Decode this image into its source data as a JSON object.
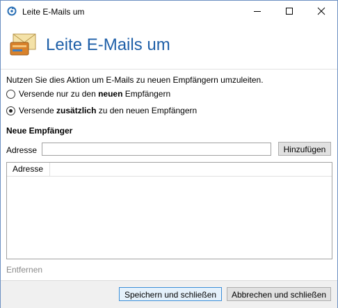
{
  "window": {
    "title": "Leite E-Mails um"
  },
  "banner": {
    "title": "Leite E-Mails um",
    "icon": "envelope-forward-icon"
  },
  "intro": {
    "text": "Nutzen Sie dies Aktion um E-Mails zu neuen Empfängern umzuleiten."
  },
  "options": {
    "only_new": {
      "prefix": "Versende nur zu den ",
      "bold": "neuen",
      "suffix": " Empfängern",
      "checked": false
    },
    "additional": {
      "prefix": "Versende ",
      "bold": "zusätzlich",
      "suffix": " zu den neuen Empfängern",
      "checked": true
    }
  },
  "recipients": {
    "section_title": "Neue Empfänger",
    "address_label": "Adresse",
    "address_value": "",
    "add_button": "Hinzufügen",
    "columns": [
      "Adresse"
    ],
    "rows": []
  },
  "remove_label": "Entfernen",
  "footer": {
    "save_button": "Speichern und schließen",
    "cancel_button": "Abbrechen und schließen"
  },
  "colors": {
    "accent": "#1e5fa8",
    "window_border": "#6b8fc2",
    "footer_bg": "#f0f0f0"
  }
}
